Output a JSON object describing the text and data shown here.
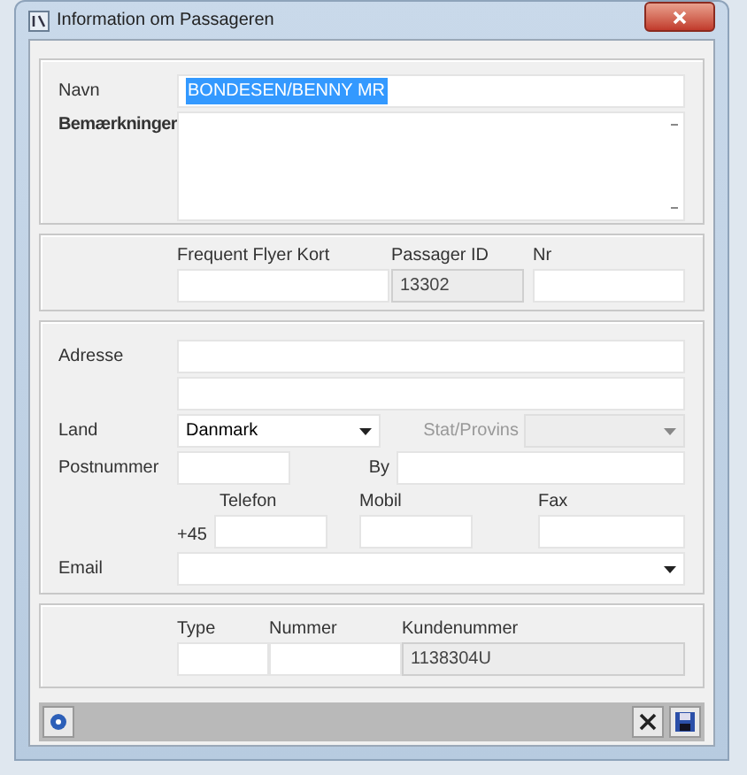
{
  "window": {
    "title": "Information om Passageren"
  },
  "name_section": {
    "name": {
      "label": "Navn",
      "value": "BONDESEN/BENNY MR",
      "selected": true
    },
    "remarks": {
      "label": "Bemærkninger"
    }
  },
  "id_section": {
    "frequent_flyer": {
      "label": "Frequent Flyer Kort"
    },
    "passenger_id": {
      "label": "Passager ID",
      "value": "13302",
      "disabled": true
    },
    "number": {
      "label": "Nr"
    }
  },
  "address_section": {
    "address": {
      "label": "Adresse"
    },
    "country": {
      "label": "Land",
      "value": "Danmark"
    },
    "state": {
      "label": "Stat/Provins",
      "disabled": true
    },
    "postal_code": {
      "label": "Postnummer"
    },
    "city": {
      "label": "By"
    },
    "phone": {
      "label": "Telefon",
      "prefix": "+45"
    },
    "mobile": {
      "label": "Mobil"
    },
    "fax": {
      "label": "Fax"
    },
    "email": {
      "label": "Email"
    }
  },
  "card_section": {
    "type": {
      "label": "Type"
    },
    "number": {
      "label": "Nummer"
    },
    "customer_number": {
      "label": "Kundenummer",
      "value": "1138304U",
      "disabled": true
    }
  }
}
